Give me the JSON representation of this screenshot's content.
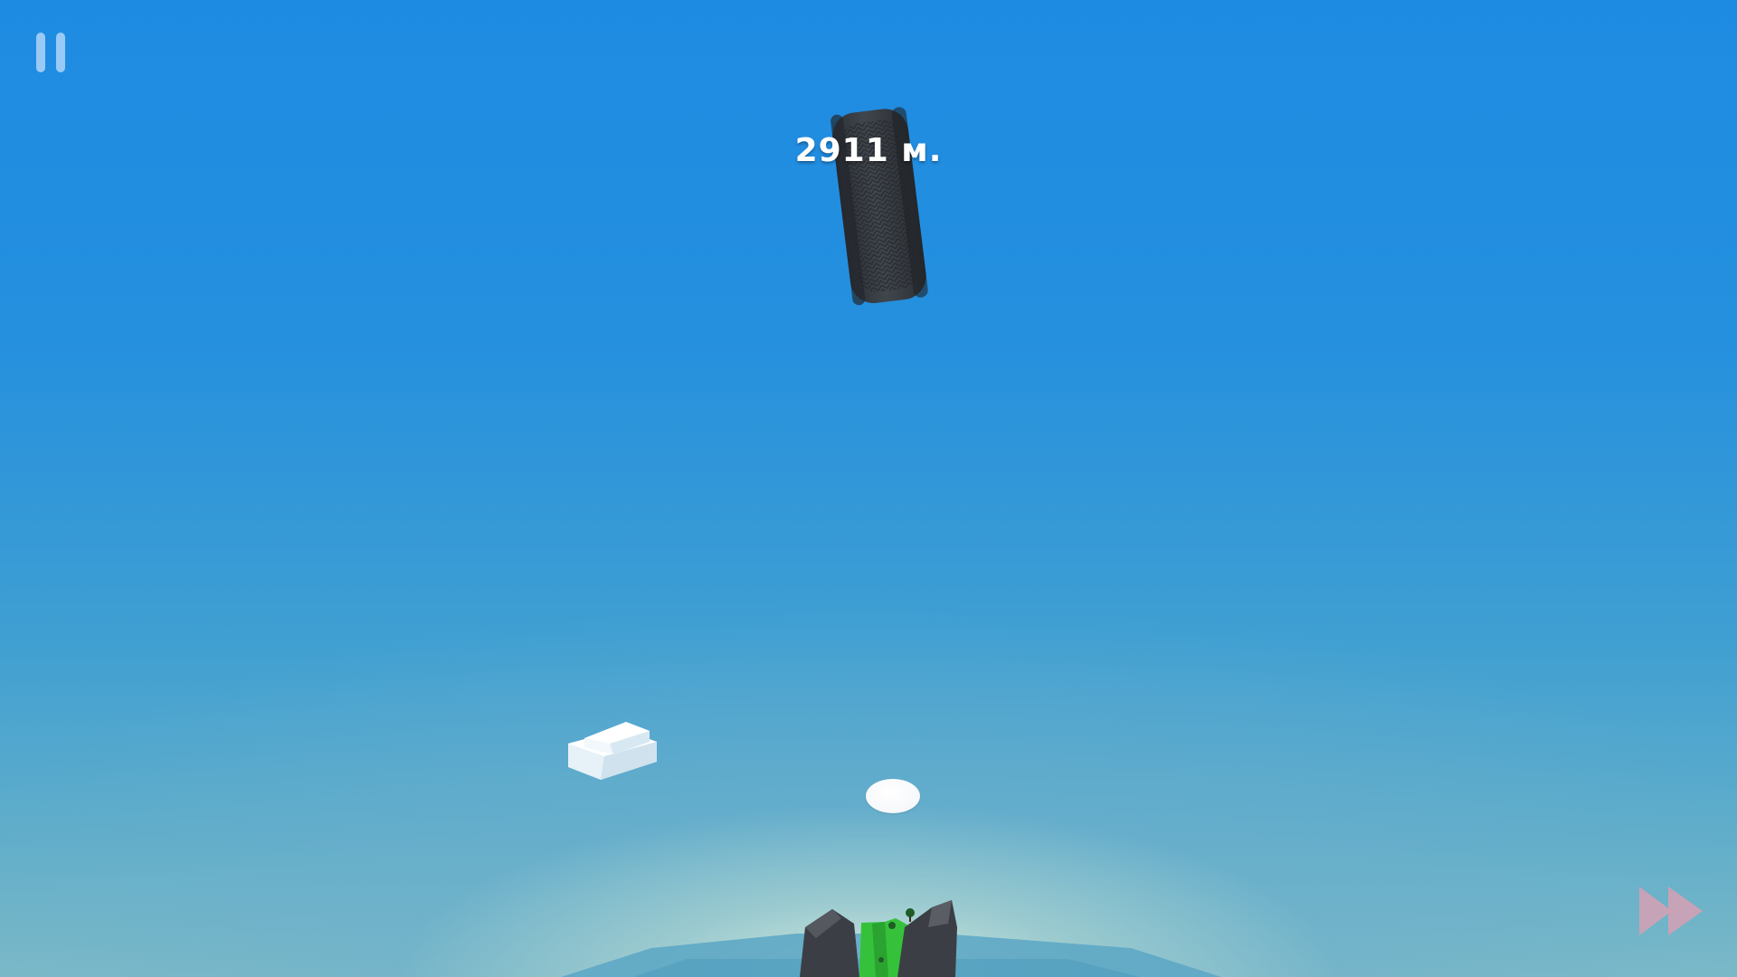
{
  "hud": {
    "distance": "2911 м.",
    "pause_icon": "pause-icon",
    "fast_forward_icon": "fast-forward-icon"
  },
  "scene": {
    "objects": [
      "tire",
      "cloud-block",
      "egg",
      "rocky-island"
    ]
  },
  "colors": {
    "sky_top": "#1e8be3",
    "sky_horizon": "#7cbac6",
    "pause": "#a0cdf5",
    "fast_forward": "#d6a0b4",
    "tire": "#3a3f46",
    "grass": "#35c23a",
    "rock": "#3b3f45"
  }
}
